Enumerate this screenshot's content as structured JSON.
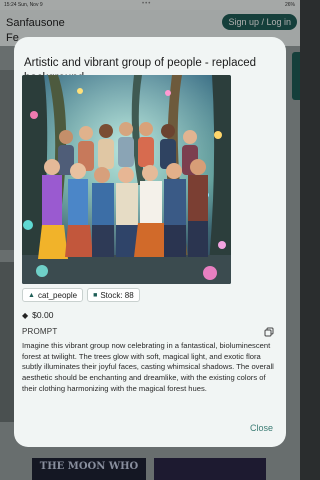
{
  "status_bar": {
    "time": "15:24  Sun, Nov 9",
    "dots": "•••",
    "right": "26%"
  },
  "app": {
    "title": "Sanfausone",
    "subtitle": "Fe",
    "signup_label": "Sign up / Log in",
    "bottom_card_text": "THE MOON WHO"
  },
  "dialog": {
    "title": "Artistic and vibrant group of people - replaced background",
    "image_alt": "Group of people in an enchanted bioluminescent forest",
    "tags": [
      {
        "icon": "users-icon",
        "label": "cat_people"
      },
      {
        "icon": "stock-icon",
        "label": "Stock: 88"
      }
    ],
    "price": "$0.00",
    "prompt_label": "PROMPT",
    "prompt_text": "Imagine this vibrant group now celebrating in a fantastical, bioluminescent forest at twilight. The trees glow with soft, magical light, and exotic flora subtly illuminates their joyful faces, casting whimsical shadows. The overall aesthetic should be enchanting and dreamlike, with the existing colors of their clothing harmonizing with the magical forest hues.",
    "close_label": "Close"
  },
  "colors": {
    "accent": "#1f5e57",
    "dialog_bg": "#f1f5f4",
    "link": "#3b7c74"
  }
}
